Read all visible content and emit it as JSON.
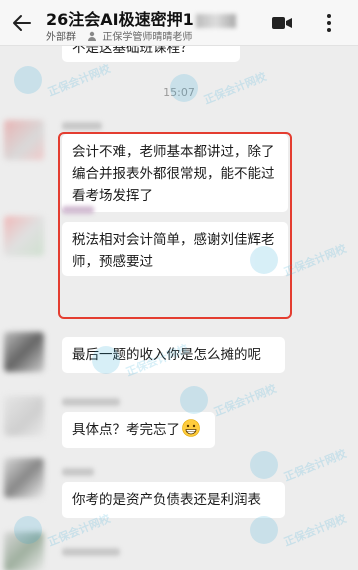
{
  "header": {
    "title": "26注会AI极速密押1",
    "group_type": "外部群",
    "org_name": "正保学管师晴晴老师"
  },
  "chat": {
    "partial_top_message": "不是这基础班课程？",
    "timestamp": "15:07",
    "messages": [
      {
        "text": "会计不难，老师基本都讲过，除了编合并报表外都很常规，能不能过看考场发挥了"
      },
      {
        "text": "税法相对会计简单，感谢刘佳辉老师，预感要过"
      },
      {
        "text": "最后一题的收入你是怎么摊的呢"
      },
      {
        "text": "具体点？考完忘了",
        "emoji": "grinning-face-emoji"
      },
      {
        "text": "你考的是资产负债表还是利润表"
      }
    ]
  },
  "watermark": {
    "text": "正保会计网校"
  },
  "colors": {
    "highlight_border": "#e43d30",
    "watermark": "#2aa8d8"
  }
}
